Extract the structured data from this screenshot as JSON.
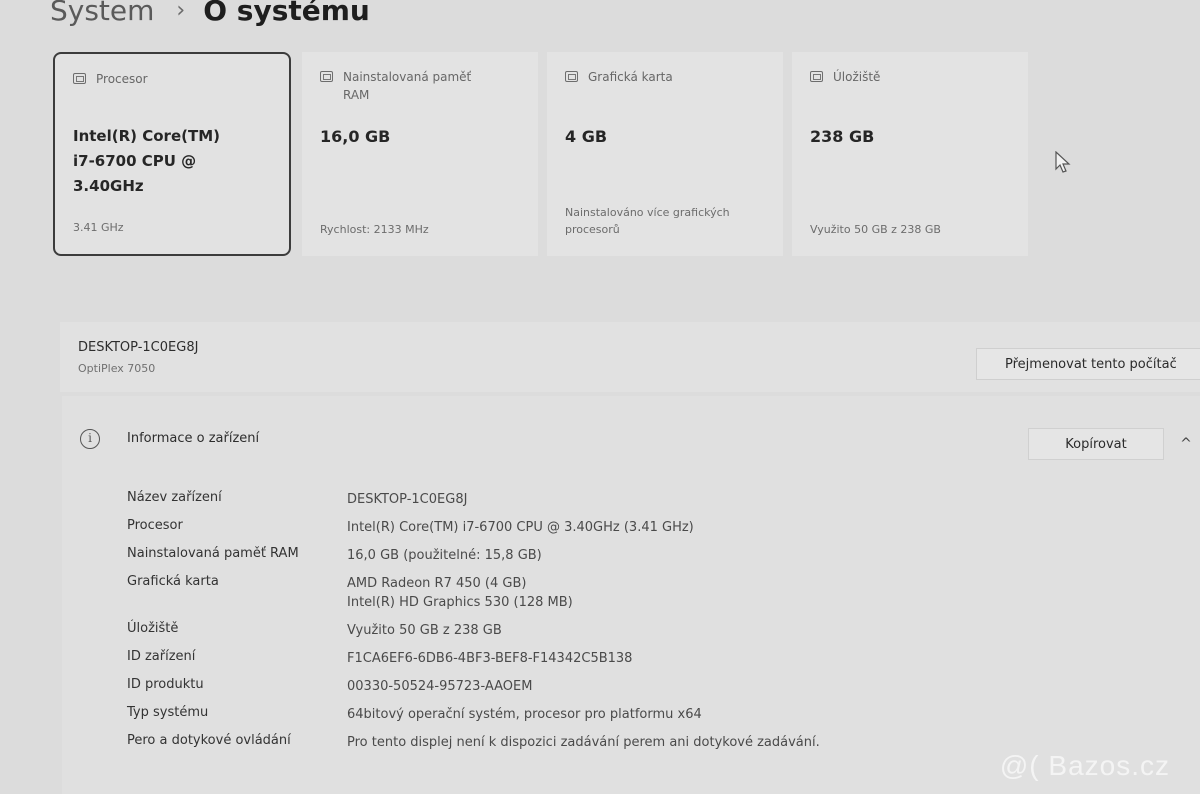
{
  "breadcrumb": {
    "parent": "System",
    "separator": "›",
    "current": "O systému"
  },
  "cards": [
    {
      "title": "Procesor",
      "value": "Intel(R) Core(TM)\ni7-6700 CPU @\n3.40GHz",
      "sub": "3.41 GHz",
      "icon": "processor-icon"
    },
    {
      "title": "Nainstalovaná paměť\nRAM",
      "value": "16,0 GB",
      "sub": "Rychlost: 2133 MHz",
      "icon": "ram-icon"
    },
    {
      "title": "Grafická karta",
      "value": "4 GB",
      "sub": "Nainstalováno více grafických\nprocesorů",
      "icon": "gpu-icon"
    },
    {
      "title": "Úložiště",
      "value": "238 GB",
      "sub": "Využito 50 GB z 238 GB",
      "icon": "storage-icon"
    }
  ],
  "device": {
    "name": "DESKTOP-1C0EG8J",
    "model": "OptiPlex 7050",
    "rename_label": "Přejmenovat tento počítač"
  },
  "info": {
    "title": "Informace o zařízení",
    "copy_label": "Kopírovat",
    "icon_glyph": "i",
    "chevron_glyph": "^",
    "rows": [
      {
        "label": "Název zařízení",
        "value": [
          "DESKTOP-1C0EG8J"
        ]
      },
      {
        "label": "Procesor",
        "value": [
          "Intel(R) Core(TM) i7-6700 CPU @ 3.40GHz (3.41 GHz)"
        ]
      },
      {
        "label": "Nainstalovaná paměť RAM",
        "value": [
          "16,0 GB (použitelné: 15,8 GB)"
        ]
      },
      {
        "label": "Grafická karta",
        "value": [
          "AMD Radeon R7 450 (4 GB)",
          "Intel(R) HD Graphics 530 (128 MB)"
        ]
      },
      {
        "label": "Úložiště",
        "value": [
          "Využito 50 GB z 238 GB"
        ]
      },
      {
        "label": "ID zařízení",
        "value": [
          "F1CA6EF6-6DB6-4BF3-BEF8-F14342C5B138"
        ]
      },
      {
        "label": "ID produktu",
        "value": [
          "00330-50524-95723-AAOEM"
        ]
      },
      {
        "label": "Typ systému",
        "value": [
          "64bitový operační systém, procesor pro platformu x64"
        ]
      },
      {
        "label": "Pero a dotykové ovládání",
        "value": [
          "Pro tento displej není k dispozici zadávání perem ani dotykové zadávání."
        ]
      }
    ]
  },
  "watermark": "@( Bazos.cz"
}
